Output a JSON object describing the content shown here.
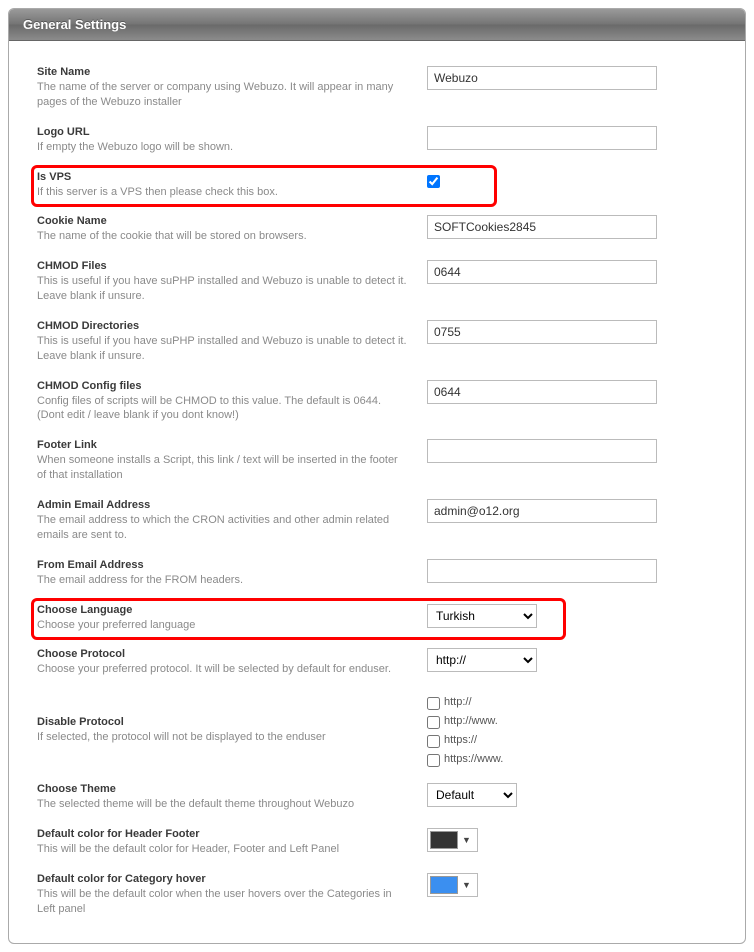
{
  "header": "General Settings",
  "rows": {
    "siteName": {
      "title": "Site Name",
      "desc": "The name of the server or company using Webuzo. It will appear in many pages of the Webuzo installer",
      "value": "Webuzo"
    },
    "logoUrl": {
      "title": "Logo URL",
      "desc": "If empty the Webuzo logo will be shown.",
      "value": ""
    },
    "isVps": {
      "title": "Is VPS",
      "desc": "If this server is a VPS then please check this box."
    },
    "cookie": {
      "title": "Cookie Name",
      "desc": "The name of the cookie that will be stored on browsers.",
      "value": "SOFTCookies2845"
    },
    "chmodFiles": {
      "title": "CHMOD Files",
      "desc": "This is useful if you have suPHP installed and Webuzo is unable to detect it. Leave blank if unsure.",
      "value": "0644"
    },
    "chmodDirs": {
      "title": "CHMOD Directories",
      "desc": "This is useful if you have suPHP installed and Webuzo is unable to detect it. Leave blank if unsure.",
      "value": "0755"
    },
    "chmodConf": {
      "title": "CHMOD Config files",
      "desc": "Config files of scripts will be CHMOD to this value. The default is 0644. (Dont edit / leave blank if you dont know!)",
      "value": "0644"
    },
    "footer": {
      "title": "Footer Link",
      "desc": "When someone installs a Script, this link / text will be inserted in the footer of that installation",
      "value": ""
    },
    "adminEmail": {
      "title": "Admin Email Address",
      "desc": "The email address to which the CRON activities and other admin related emails are sent to.",
      "value": "admin@o12.org"
    },
    "fromEmail": {
      "title": "From Email Address",
      "desc": "The email address for the FROM headers.",
      "value": ""
    },
    "lang": {
      "title": "Choose Language",
      "desc": "Choose your preferred language",
      "value": "Turkish"
    },
    "proto": {
      "title": "Choose Protocol",
      "desc": "Choose your preferred protocol. It will be selected by default for enduser.",
      "value": "http://"
    },
    "disableProto": {
      "title": "Disable Protocol",
      "desc": "If selected, the protocol will not be displayed to the enduser",
      "opts": [
        "http://",
        "http://www.",
        "https://",
        "https://www."
      ]
    },
    "theme": {
      "title": "Choose Theme",
      "desc": "The selected theme will be the default theme throughout Webuzo",
      "value": "Default"
    },
    "colorHeader": {
      "title": "Default color for Header Footer",
      "desc": "This will be the default color for Header, Footer and Left Panel",
      "color": "#333333"
    },
    "colorHover": {
      "title": "Default color for Category hover",
      "desc": "This will be the default color when the user hovers over the Categories in Left panel",
      "color": "#3b8ff0"
    }
  }
}
